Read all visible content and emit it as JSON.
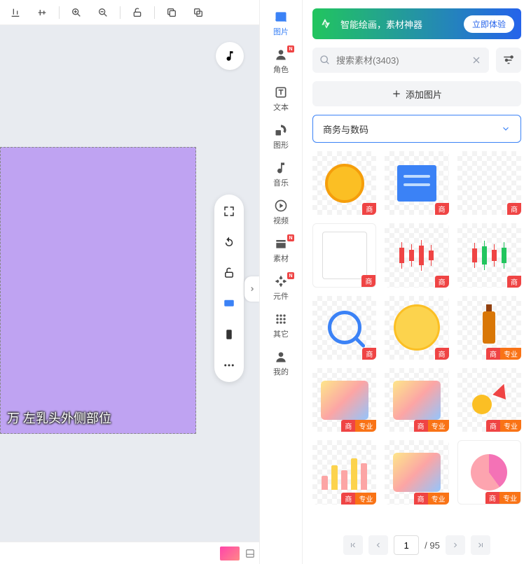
{
  "toolbar": {
    "icons": [
      "align-bottom",
      "align-middle",
      "zoom-in",
      "zoom-out",
      "unlock",
      "copy",
      "duplicate"
    ]
  },
  "canvas": {
    "caption": "万  左乳头外侧部位"
  },
  "float_tools": [
    "fullscreen",
    "rotate",
    "unlock",
    "desktop",
    "mobile",
    "more"
  ],
  "nav": {
    "items": [
      {
        "key": "image",
        "label": "图片",
        "badge": false,
        "active": true
      },
      {
        "key": "role",
        "label": "角色",
        "badge": true,
        "active": false
      },
      {
        "key": "text",
        "label": "文本",
        "badge": false,
        "active": false
      },
      {
        "key": "shape",
        "label": "图形",
        "badge": false,
        "active": false
      },
      {
        "key": "music",
        "label": "音乐",
        "badge": false,
        "active": false
      },
      {
        "key": "video",
        "label": "视频",
        "badge": false,
        "active": false
      },
      {
        "key": "material",
        "label": "素材",
        "badge": true,
        "active": false
      },
      {
        "key": "component",
        "label": "元件",
        "badge": true,
        "active": false
      },
      {
        "key": "other",
        "label": "其它",
        "badge": false,
        "active": false
      },
      {
        "key": "mine",
        "label": "我的",
        "badge": false,
        "active": false
      }
    ]
  },
  "panel": {
    "promo_text": "智能绘画，素材神器",
    "promo_cta": "立即体验",
    "search_placeholder": "搜索素材(3403)",
    "add_button": "添加图片",
    "category": "商务与数码",
    "tags": {
      "commercial": "商",
      "pro": "专业"
    },
    "pager": {
      "current": "1",
      "total": "/ 95"
    }
  },
  "assets": [
    {
      "visual": "coin",
      "tags": [
        "commercial"
      ]
    },
    {
      "visual": "note",
      "tags": [
        "commercial"
      ]
    },
    {
      "visual": "blank",
      "tags": [
        "commercial"
      ]
    },
    {
      "visual": "frame",
      "tags": [
        "commercial"
      ]
    },
    {
      "visual": "candles-red",
      "tags": [
        "commercial"
      ]
    },
    {
      "visual": "candles-mix",
      "tags": [
        "commercial"
      ]
    },
    {
      "visual": "magnifier",
      "tags": [
        "commercial"
      ]
    },
    {
      "visual": "coin-lg",
      "tags": [
        "commercial"
      ]
    },
    {
      "visual": "bottle",
      "tags": [
        "commercial",
        "pro"
      ]
    },
    {
      "visual": "biz1",
      "tags": [
        "commercial",
        "pro"
      ]
    },
    {
      "visual": "biz2",
      "tags": [
        "commercial",
        "pro"
      ]
    },
    {
      "visual": "arrow-up",
      "tags": [
        "commercial",
        "pro"
      ]
    },
    {
      "visual": "bars",
      "tags": [
        "commercial",
        "pro"
      ]
    },
    {
      "visual": "biz3",
      "tags": [
        "commercial",
        "pro"
      ]
    },
    {
      "visual": "pie",
      "tags": [
        "commercial",
        "pro"
      ]
    }
  ]
}
